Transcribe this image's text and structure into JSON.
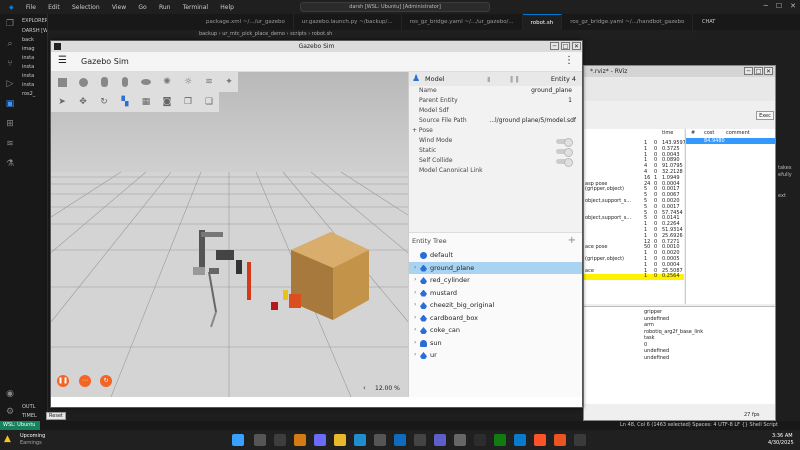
{
  "vscode": {
    "menu": [
      "File",
      "Edit",
      "Selection",
      "View",
      "Go",
      "Run",
      "Terminal",
      "Help"
    ],
    "search": "darsh [WSL: Ubuntu] [Administrator]",
    "tabs": [
      "package.xml ~/.../ur_gazebo",
      "ur.gazebo.launch.py ~/backup/...",
      "ros_gz_bridge.yaml ~/.../ur_gazebo/...",
      "robot.sh",
      "ros_gz_bridge.yaml ~/.../handbot_gazebo"
    ],
    "chat_label": "CHAT",
    "breadcrumb": "backup › ur_mtc_pick_place_demo › scripts › robot.sh",
    "explorer_title": "EXPLORER",
    "explorer_root": "DARSH [WSL: UBUNTU]",
    "explorer_lines": [
      "back",
      "imag",
      "insta",
      "insta",
      "insta",
      "insta",
      "ros2_",
      "OUTL",
      "TIMEL"
    ],
    "status_left": "WSL: Ubuntu",
    "status_right": "Ln 48, Col 6 (1463 selected)   Spaces: 4   UTF-8   LF   {} Shell Script"
  },
  "taskbar": {
    "weather_title": "Upcoming",
    "weather_sub": "Earnings",
    "time": "3:36 AM",
    "date": "4/30/2025"
  },
  "rviz": {
    "title": "*.rviz* - RViz",
    "exec_label": "Exec",
    "col_headers": [
      "#",
      "cost",
      "comment"
    ],
    "col_time": "time",
    "selected_cost": "84.9480",
    "rows": [
      {
        "a": "1",
        "b": "0",
        "t": "143.9597"
      },
      {
        "a": "1",
        "b": "0",
        "t": "0.3725"
      },
      {
        "a": "1",
        "b": "0",
        "t": "0.0043"
      },
      {
        "a": "1",
        "b": "0",
        "t": "0.0890"
      },
      {
        "a": "4",
        "b": "0",
        "t": "91.0795"
      },
      {
        "a": "4",
        "b": "0",
        "t": "32.2128"
      },
      {
        "a": "16",
        "b": "1",
        "t": "1.0949"
      },
      {
        "a": "24",
        "b": "0",
        "t": "0.0004"
      },
      {
        "a": "5",
        "b": "0",
        "t": "0.0017"
      },
      {
        "a": "5",
        "b": "0",
        "t": "0.0067"
      },
      {
        "a": "5",
        "b": "0",
        "t": "0.0020"
      },
      {
        "a": "5",
        "b": "0",
        "t": "0.0017"
      },
      {
        "a": "5",
        "b": "0",
        "t": "57.7454"
      },
      {
        "a": "5",
        "b": "0",
        "t": "0.0141"
      },
      {
        "a": "1",
        "b": "0",
        "t": "0.2264"
      },
      {
        "a": "1",
        "b": "0",
        "t": "51.9314"
      },
      {
        "a": "1",
        "b": "0",
        "t": "25.6926"
      },
      {
        "a": "12",
        "b": "0",
        "t": "0.7271"
      },
      {
        "a": "50",
        "b": "0",
        "t": "0.0010"
      },
      {
        "a": "1",
        "b": "0",
        "t": "0.0020"
      },
      {
        "a": "1",
        "b": "0",
        "t": "0.0005"
      },
      {
        "a": "1",
        "b": "0",
        "t": "0.0004"
      },
      {
        "a": "1",
        "b": "0",
        "t": "25.5087"
      },
      {
        "a": "1",
        "b": "0",
        "t": "0.2564"
      }
    ],
    "stage_names": [
      "",
      "",
      "",
      "",
      "",
      "",
      "",
      "asp pose",
      "(gripper,object)",
      "",
      "object,support_s...",
      "",
      "",
      "object,support_s...",
      "",
      "",
      "",
      "",
      "ace pose",
      "",
      "(gripper,object)",
      "",
      "ace",
      ""
    ],
    "props": [
      "gripper",
      "undefined",
      "arm",
      "robotiq_arg2f_base_link",
      "task",
      "0",
      "undefined",
      "undefined"
    ],
    "fps": "27 fps",
    "reset_label": "Reset",
    "right_text": [
      "takes",
      "efully",
      "ext"
    ]
  },
  "gazebo": {
    "title": "Gazebo Sim",
    "app_name": "Gazebo Sim",
    "component": {
      "title": "Model",
      "entity": "Entity 4",
      "name_label": "Name",
      "name_value": "ground_plane",
      "parent_label": "Parent Entity",
      "parent_value": "1",
      "sdf_label": "Model Sdf",
      "path_label": "Source File Path",
      "path_value": "...l/ground plane/5/model.sdf",
      "pose_label": "+ Pose",
      "wind_label": "Wind Mode",
      "static_label": "Static",
      "collide_label": "Self Collide",
      "canonical_label": "Model Canonical Link"
    },
    "tree_title": "Entity Tree",
    "tree": [
      "default",
      "ground_plane",
      "red_cylinder",
      "mustard",
      "cheezit_big_original",
      "cardboard_box",
      "coke_can",
      "sun",
      "ur"
    ],
    "zoom": "12.00 %",
    "colors": {
      "accent": "#f26522",
      "selection": "#a8d4f2",
      "vscode_blue": "#0078d4"
    }
  }
}
